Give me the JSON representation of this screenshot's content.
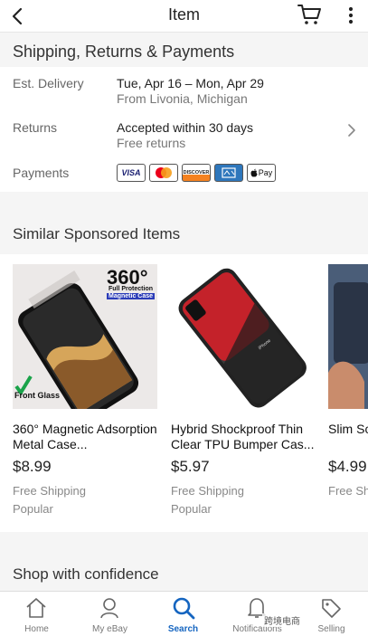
{
  "header": {
    "title": "Item"
  },
  "shipping": {
    "title": "Shipping, Returns & Payments",
    "delivery_label": "Est. Delivery",
    "delivery_value": "Tue, Apr 16 – Mon, Apr 29",
    "delivery_from": "From Livonia, Michigan",
    "returns_label": "Returns",
    "returns_value": "Accepted within 30 days",
    "returns_sub": "Free returns",
    "payments_label": "Payments",
    "payment_methods": [
      "VISA",
      "Mastercard",
      "DISCOVER",
      "American Express",
      "Apple Pay"
    ],
    "card_labels": {
      "visa": "VISA",
      "discover": "DISCOVER",
      "applepay": "Pay"
    }
  },
  "similar": {
    "title": "Similar Sponsored Items",
    "items": [
      {
        "title": "360° Magnetic Adsorption Metal Case...",
        "price": "$8.99",
        "shipping": "Free Shipping",
        "badge": "Popular",
        "image_text": [
          "360°",
          "Full Protection",
          "Magnetic Case",
          "Front Glass"
        ]
      },
      {
        "title": "Hybrid Shockproof Thin Clear TPU Bumper Cas...",
        "price": "$5.97",
        "shipping": "Free Shipping",
        "badge": "Popular",
        "image_text": [
          "iPhone"
        ]
      },
      {
        "title": "Slim Sc Shockp",
        "price": "$4.99",
        "shipping": "Free Sh"
      }
    ]
  },
  "confidence": {
    "title": "Shop with confidence"
  },
  "nav": {
    "items": [
      {
        "label": "Home"
      },
      {
        "label": "My eBay"
      },
      {
        "label": "Search"
      },
      {
        "label": "Notifications"
      },
      {
        "label": "Selling"
      }
    ]
  },
  "watermark": {
    "text": "跨境电商"
  },
  "colors": {
    "accent": "#1565c0",
    "band": "#f5f5f5"
  }
}
